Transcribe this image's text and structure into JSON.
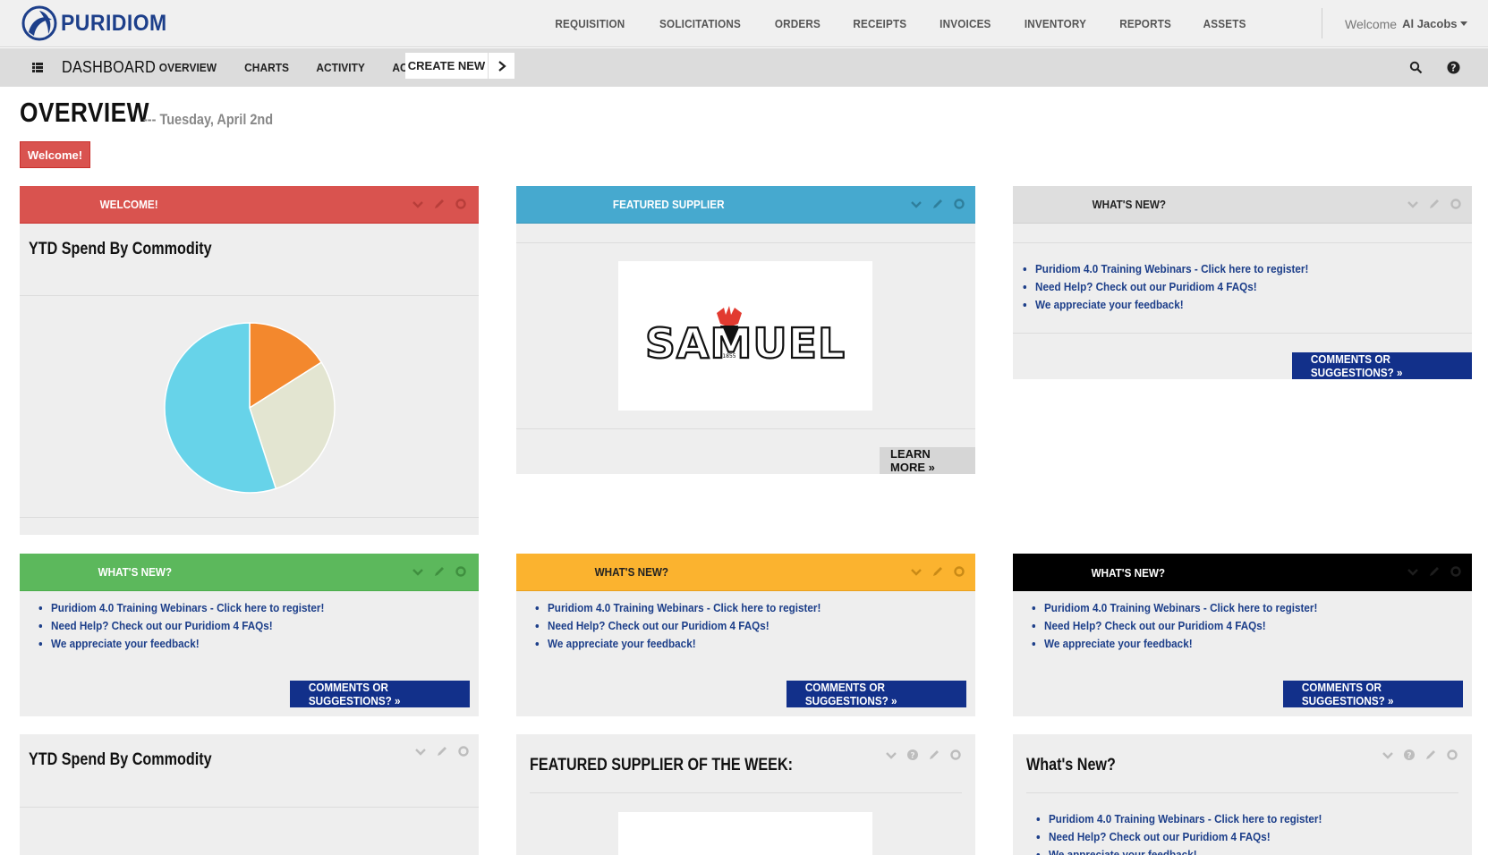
{
  "brand": {
    "name": "PURIDIOM",
    "color": "#1d3f8a"
  },
  "main_menu": [
    "REQUISITION",
    "SOLICITATIONS",
    "ORDERS",
    "RECEIPTS",
    "INVOICES",
    "INVENTORY",
    "REPORTS",
    "ASSETS"
  ],
  "user": {
    "welcome": "Welcome",
    "name": "Al Jacobs"
  },
  "subnav": {
    "title": "DASHBOARD",
    "items": [
      "OVERVIEW",
      "CHARTS",
      "ACTIVITY",
      "ACTIONS"
    ],
    "create_new": "CREATE NEW"
  },
  "page": {
    "title": "OVERVIEW",
    "date": "--- Tuesday, April 2nd",
    "welcome_button": "Welcome!"
  },
  "links": [
    "Puridiom 4.0 Training Webinars - Click here to register!",
    "Need Help? Check out our Puridiom 4 FAQs!",
    "We appreciate your feedback!"
  ],
  "buttons": {
    "comments": "COMMENTS OR SUGGESTIONS? »",
    "learn_more": "LEARN MORE »"
  },
  "widgets": {
    "welcome": {
      "title": "WELCOME!",
      "color": "#d9534f",
      "body_title": "YTD Spend By Commodity"
    },
    "featured": {
      "title": "FEATURED SUPPLIER",
      "color": "#46a9cf"
    },
    "whatsnew_gray": {
      "title": "WHAT'S NEW?",
      "color": "#dedede"
    },
    "whatsnew_green": {
      "title": "WHAT'S NEW?",
      "color": "#5cb85c"
    },
    "whatsnew_orange": {
      "title": "WHAT'S NEW?",
      "color": "#fbb32f"
    },
    "whatsnew_black": {
      "title": "WHAT'S NEW?",
      "color": "#000000"
    },
    "ytd_bottom": {
      "title": "YTD Spend By Commodity"
    },
    "featured_week": {
      "title": "FEATURED SUPPLIER OF THE WEEK:"
    },
    "whatsnew_bottom": {
      "title": "What's New?"
    }
  },
  "supplier_logo": {
    "text": "SAMUEL",
    "year": "1855"
  },
  "chart_data": {
    "type": "pie",
    "values": [
      16,
      29,
      55
    ],
    "colors": [
      "#f3882d",
      "#e3e5d1",
      "#67d3e9"
    ]
  }
}
